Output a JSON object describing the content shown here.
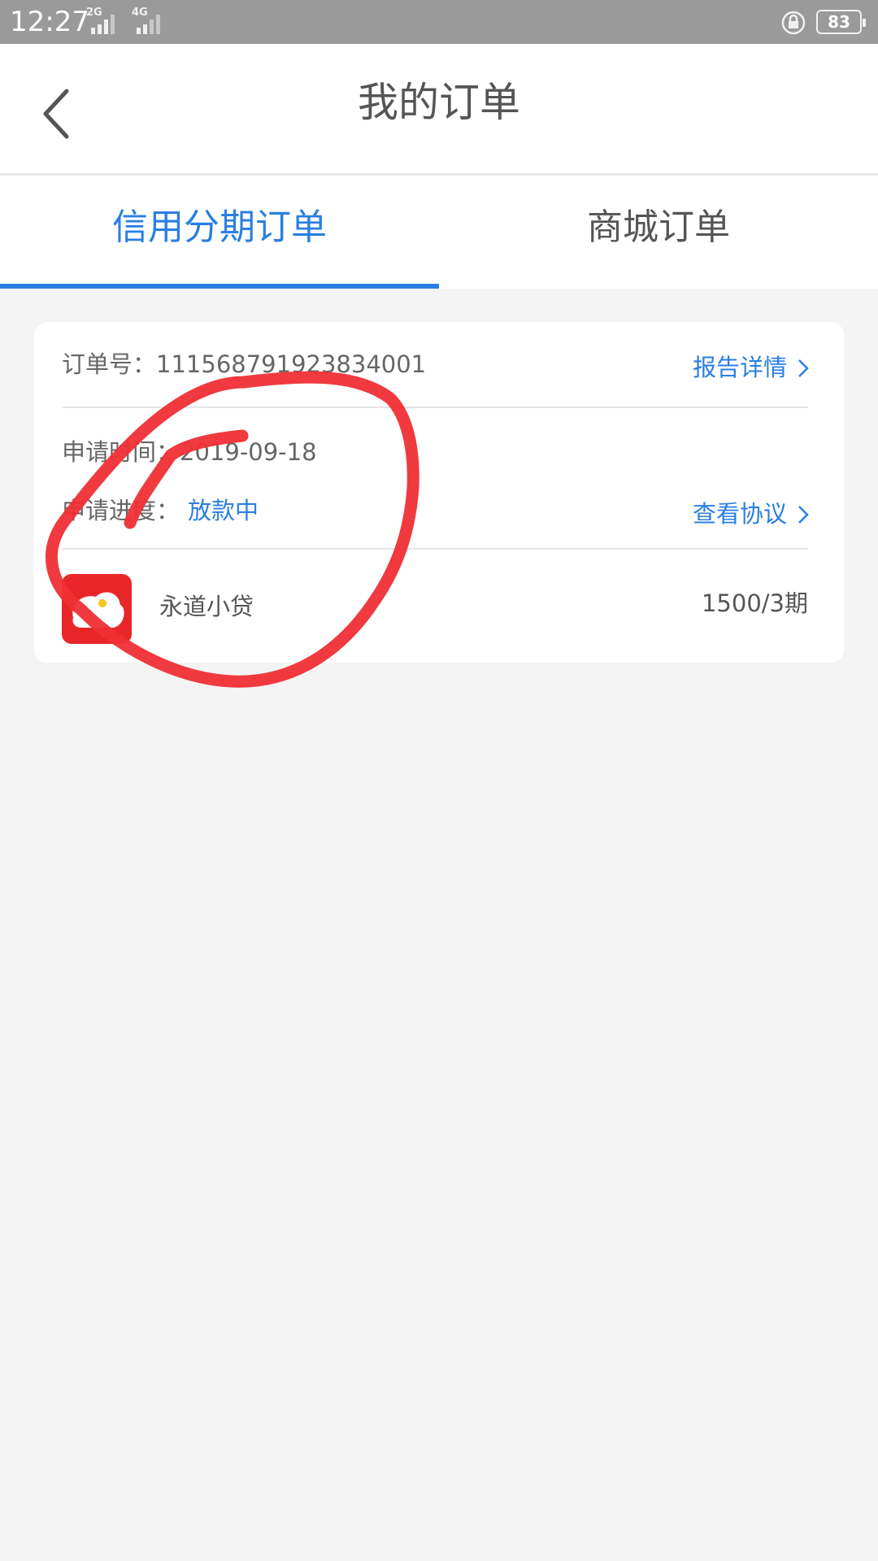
{
  "status_bar": {
    "time": "12:27",
    "network_1": "2G",
    "network_2": "4G",
    "battery": "83"
  },
  "header": {
    "title": "我的订单"
  },
  "tabs": [
    {
      "label": "信用分期订单",
      "active": true
    },
    {
      "label": "商城订单",
      "active": false
    }
  ],
  "order": {
    "number_label": "订单号：",
    "number_value": "111568791923834001",
    "report_link": "报告详情",
    "apply_time_label": "申请时间：",
    "apply_time_value": "2019-09-18",
    "progress_label": "申请进度：",
    "progress_value": "放款中",
    "agreement_link": "查看协议",
    "product_name": "永道小贷",
    "amount": "1500/3期"
  },
  "colors": {
    "accent": "#2a7fe0",
    "status_bar": "#9a9a9a",
    "background": "#f4f4f4",
    "annotation": "#ef2f35",
    "logo": "#e8262a"
  }
}
